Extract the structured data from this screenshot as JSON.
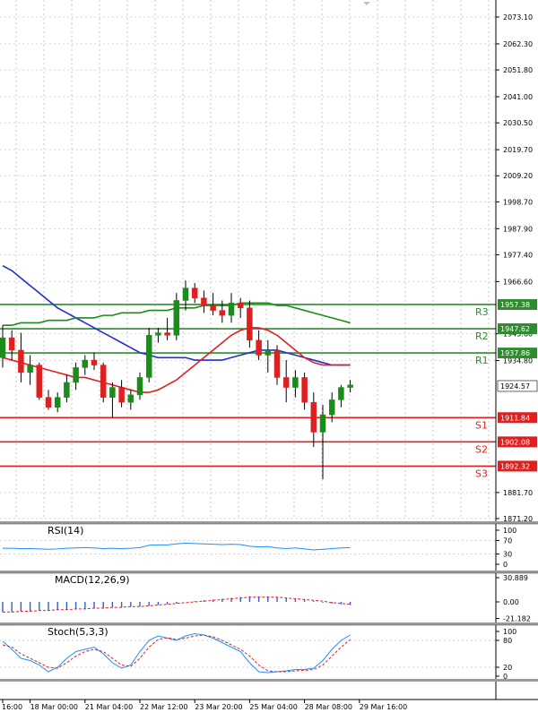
{
  "chart_data": {
    "type": "candlestick",
    "price_axis": {
      "ticks": [
        "2073.10",
        "2062.30",
        "2051.80",
        "2041.00",
        "2030.50",
        "2019.70",
        "2009.20",
        "1998.70",
        "1987.90",
        "1977.40",
        "1966.60",
        "1945.60",
        "1934.80",
        "1881.70",
        "1871.20"
      ],
      "tick_values": [
        2073.1,
        2062.3,
        2051.8,
        2041.0,
        2030.5,
        2019.7,
        2009.2,
        1998.7,
        1987.9,
        1977.4,
        1966.6,
        1945.6,
        1934.8,
        1881.7,
        1871.2
      ],
      "current_price_label": "1924.57",
      "current_price": 1924.57
    },
    "x_axis": {
      "labels": [
        "16:00",
        "18 Mar 00:00",
        "21 Mar 04:00",
        "22 Mar 12:00",
        "23 Mar 20:00",
        "25 Mar 04:00",
        "28 Mar 08:00",
        "29 Mar 16:00"
      ],
      "label_candle_index": [
        0,
        3,
        9,
        15,
        21,
        27,
        33,
        39
      ]
    },
    "levels": [
      {
        "name": "R3",
        "value": 1957.38,
        "label": "1957.38",
        "color": "#2e8b2e"
      },
      {
        "name": "R2",
        "value": 1947.62,
        "label": "1947.62",
        "color": "#2e8b2e"
      },
      {
        "name": "R1",
        "value": 1937.86,
        "label": "1937.86",
        "color": "#2e8b2e"
      },
      {
        "name": "S1",
        "value": 1911.84,
        "label": "1911.84",
        "color": "#e02020"
      },
      {
        "name": "S2",
        "value": 1902.08,
        "label": "1902.08",
        "color": "#e02020"
      },
      {
        "name": "S3",
        "value": 1892.32,
        "label": "1892.32",
        "color": "#e02020"
      }
    ],
    "candles": [
      [
        1936,
        1949,
        1932,
        1944
      ],
      [
        1944,
        1947,
        1935,
        1939
      ],
      [
        1939,
        1946,
        1926,
        1930
      ],
      [
        1930,
        1937,
        1925,
        1933
      ],
      [
        1933,
        1934,
        1919,
        1920
      ],
      [
        1920,
        1923,
        1915,
        1916
      ],
      [
        1916,
        1922,
        1914,
        1920
      ],
      [
        1920,
        1929,
        1918,
        1926
      ],
      [
        1926,
        1934,
        1923,
        1932
      ],
      [
        1932,
        1937,
        1929,
        1935
      ],
      [
        1935,
        1938,
        1931,
        1933
      ],
      [
        1933,
        1934,
        1918,
        1920
      ],
      [
        1920,
        1926,
        1912,
        1924
      ],
      [
        1924,
        1927,
        1916,
        1918
      ],
      [
        1918,
        1923,
        1915,
        1921
      ],
      [
        1921,
        1930,
        1919,
        1928
      ],
      [
        1928,
        1948,
        1926,
        1945
      ],
      [
        1945,
        1948,
        1942,
        1946
      ],
      [
        1946,
        1952,
        1943,
        1945
      ],
      [
        1945,
        1962,
        1943,
        1959
      ],
      [
        1959,
        1967,
        1955,
        1964
      ],
      [
        1964,
        1966,
        1958,
        1960
      ],
      [
        1960,
        1963,
        1954,
        1957
      ],
      [
        1957,
        1962,
        1953,
        1955
      ],
      [
        1955,
        1959,
        1950,
        1953
      ],
      [
        1953,
        1962,
        1950,
        1958
      ],
      [
        1958,
        1960,
        1952,
        1956
      ],
      [
        1956,
        1959,
        1940,
        1943
      ],
      [
        1943,
        1947,
        1935,
        1937
      ],
      [
        1937,
        1943,
        1930,
        1939
      ],
      [
        1939,
        1941,
        1925,
        1928
      ],
      [
        1928,
        1935,
        1918,
        1924
      ],
      [
        1924,
        1931,
        1920,
        1928
      ],
      [
        1928,
        1930,
        1915,
        1918
      ],
      [
        1918,
        1922,
        1900,
        1906
      ],
      [
        1906,
        1917,
        1887,
        1913
      ],
      [
        1913,
        1922,
        1910,
        1919
      ],
      [
        1919,
        1925,
        1916,
        1924
      ],
      [
        1924,
        1927,
        1922,
        1925
      ]
    ],
    "moving_averages": [
      {
        "color": "#1f2fd6",
        "values": [
          1973,
          1971,
          1968,
          1965,
          1962,
          1959,
          1956,
          1954,
          1952,
          1950,
          1948,
          1946,
          1944,
          1942,
          1940,
          1938,
          1937,
          1936,
          1936,
          1936,
          1936,
          1935,
          1935,
          1935,
          1935,
          1936,
          1937,
          1938,
          1939,
          1939,
          1939,
          1938,
          1937,
          1936,
          1935,
          1934,
          1933,
          1933,
          1933
        ]
      },
      {
        "color": "#e02020",
        "values": [
          1936,
          1935,
          1934,
          1933,
          1932,
          1931,
          1930,
          1929,
          1928,
          1928,
          1927,
          1926,
          1925,
          1924,
          1923,
          1922,
          1922,
          1923,
          1925,
          1927,
          1930,
          1933,
          1936,
          1939,
          1942,
          1945,
          1947,
          1948,
          1948,
          1947,
          1945,
          1942,
          1939,
          1936,
          1934,
          1933,
          1933,
          1933,
          1933
        ]
      },
      {
        "color": "#1a8c1a",
        "values": [
          1949,
          1949,
          1950,
          1950,
          1950,
          1951,
          1951,
          1951,
          1952,
          1952,
          1952,
          1953,
          1953,
          1954,
          1954,
          1954,
          1955,
          1955,
          1955,
          1956,
          1956,
          1956,
          1957,
          1957,
          1957,
          1957,
          1958,
          1958,
          1958,
          1958,
          1957,
          1957,
          1956,
          1955,
          1954,
          1953,
          1952,
          1951,
          1950
        ]
      }
    ],
    "indicators": {
      "rsi": {
        "label": "RSI(14)",
        "levels": [
          "100",
          "70",
          "30",
          "0"
        ],
        "color": "#1e90ff",
        "values": [
          47,
          47,
          46,
          46,
          45,
          44,
          45,
          47,
          48,
          49,
          48,
          46,
          47,
          46,
          47,
          49,
          56,
          57,
          57,
          60,
          62,
          61,
          60,
          59,
          58,
          59,
          58,
          53,
          51,
          52,
          48,
          46,
          48,
          45,
          42,
          44,
          46,
          48,
          49
        ]
      },
      "macd": {
        "label": "MACD(12,26,9)",
        "levels": [
          "30.889",
          "0.00",
          "-21.182"
        ],
        "hist_color": "#3060d0",
        "signal_color": "#e02020",
        "values": [
          -13,
          -13,
          -12,
          -12,
          -11,
          -11,
          -10,
          -10,
          -9,
          -9,
          -8,
          -8,
          -7,
          -7,
          -6,
          -6,
          -5,
          -4,
          -3,
          -2,
          0,
          1,
          2,
          3,
          4,
          5,
          6,
          7,
          7,
          7,
          6,
          5,
          4,
          3,
          1,
          -1,
          -2,
          -3,
          -4
        ],
        "signal": [
          -13,
          -13,
          -12,
          -12,
          -11,
          -11,
          -10,
          -10,
          -9,
          -9,
          -8,
          -8,
          -7,
          -7,
          -6,
          -6,
          -5,
          -4,
          -3,
          -2,
          -1,
          0,
          1,
          2,
          3,
          4,
          5,
          6,
          6,
          6,
          6,
          5,
          4,
          3,
          2,
          1,
          -1,
          -2,
          -3
        ]
      },
      "stoch": {
        "label": "Stoch(5,3,3)",
        "levels": [
          "100",
          "80",
          "20",
          "0"
        ],
        "k_color": "#1e90ff",
        "d_color": "#e02020",
        "k": [
          78,
          60,
          40,
          35,
          25,
          10,
          20,
          40,
          55,
          60,
          65,
          50,
          30,
          18,
          25,
          55,
          80,
          90,
          85,
          80,
          90,
          95,
          92,
          85,
          75,
          65,
          55,
          30,
          10,
          8,
          10,
          12,
          15,
          15,
          18,
          35,
          60,
          80,
          92
        ],
        "d": [
          70,
          65,
          50,
          40,
          30,
          20,
          18,
          30,
          45,
          55,
          60,
          55,
          40,
          25,
          22,
          40,
          65,
          82,
          86,
          82,
          85,
          90,
          92,
          88,
          80,
          70,
          60,
          45,
          25,
          12,
          10,
          10,
          12,
          13,
          15,
          25,
          45,
          65,
          82
        ]
      }
    }
  }
}
